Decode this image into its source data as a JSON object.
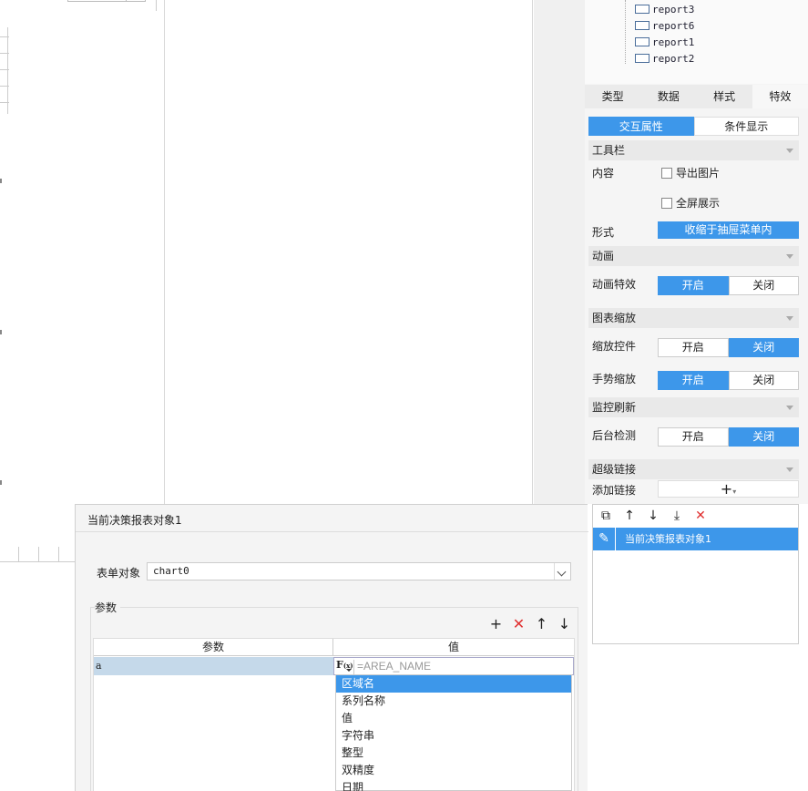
{
  "tree": {
    "items": [
      "report3",
      "report6",
      "report1",
      "report2"
    ]
  },
  "tabs": {
    "items": [
      "类型",
      "数据",
      "样式",
      "特效"
    ],
    "active": "特效"
  },
  "subtabs": {
    "interaction": "交互属性",
    "condition": "条件显示"
  },
  "toolbar_section": {
    "title": "工具栏",
    "content_label": "内容",
    "export_image": "导出图片",
    "fullscreen": "全屏展示",
    "form_label": "形式",
    "form_value": "收缩于抽屉菜单内"
  },
  "animation_section": {
    "title": "动画",
    "effect_label": "动画特效",
    "on": "开启",
    "off": "关闭",
    "selected": "开启"
  },
  "zoom_section": {
    "title": "图表缩放",
    "control_label": "缩放控件",
    "control_selected": "关闭",
    "gesture_label": "手势缩放",
    "gesture_selected": "开启",
    "on": "开启",
    "off": "关闭"
  },
  "monitor_section": {
    "title": "监控刷新",
    "bg_label": "后台检测",
    "bg_selected": "关闭",
    "on": "开启",
    "off": "关闭"
  },
  "hyperlink_section": {
    "title": "超级链接",
    "add_label": "添加链接",
    "add_icon": "+",
    "add_caret": "▾"
  },
  "link_list": {
    "items": [
      "当前决策报表对象1"
    ],
    "tools": [
      "copy-icon",
      "arrow-up-icon",
      "arrow-down-icon",
      "move-bottom-icon",
      "delete-icon"
    ]
  },
  "dialog": {
    "title": "当前决策报表对象1",
    "form_object_label": "表单对象",
    "form_object_value": "chart0",
    "params_label": "参数",
    "param_col": "参数",
    "value_col": "值",
    "row_key": "a",
    "row_value_placeholder": "=AREA_NAME",
    "fx_label": "F",
    "fx_sub": "(x)"
  },
  "dropdown": {
    "items": [
      "区域名",
      "系列名称",
      "值",
      "字符串",
      "整型",
      "双精度",
      "日期"
    ],
    "selected": "区域名"
  },
  "colors": {
    "accent": "#3d97ea",
    "delete": "#e03030",
    "row_highlight": "#c5d9ea"
  }
}
